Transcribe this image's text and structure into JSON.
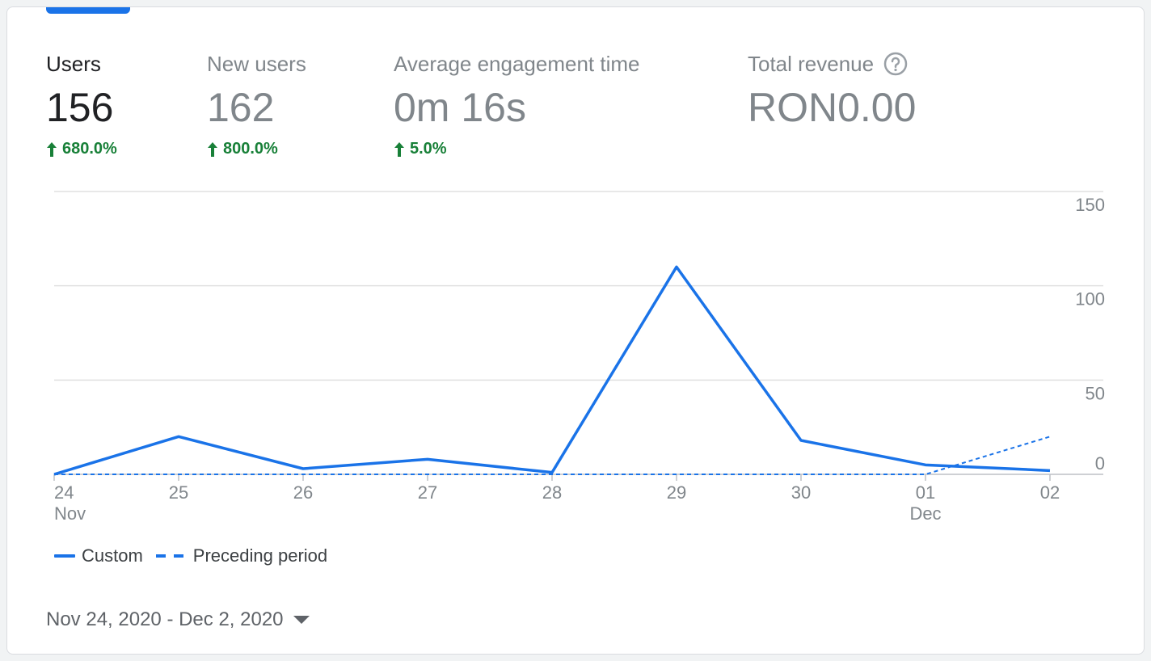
{
  "metrics": [
    {
      "label": "Users",
      "value": "156",
      "change": "680.0%"
    },
    {
      "label": "New users",
      "value": "162",
      "change": "800.0%"
    },
    {
      "label": "Average engagement time",
      "value": "0m 16s",
      "change": "5.0%"
    },
    {
      "label": "Total revenue",
      "value": "RON0.00"
    }
  ],
  "legend": {
    "custom": "Custom",
    "preceding": "Preceding period"
  },
  "date_range": "Nov 24, 2020 - Dec 2, 2020",
  "colors": {
    "accent": "#1a73e8",
    "positive": "#188038",
    "grid": "#e0e0e0",
    "axis_text": "#80868b"
  },
  "chart_data": {
    "type": "line",
    "x_ticks": [
      {
        "day": "24",
        "month": "Nov"
      },
      {
        "day": "25",
        "month": ""
      },
      {
        "day": "26",
        "month": ""
      },
      {
        "day": "27",
        "month": ""
      },
      {
        "day": "28",
        "month": ""
      },
      {
        "day": "29",
        "month": ""
      },
      {
        "day": "30",
        "month": ""
      },
      {
        "day": "01",
        "month": "Dec"
      },
      {
        "day": "02",
        "month": ""
      }
    ],
    "y_ticks": [
      0,
      50,
      100,
      150
    ],
    "ylim": [
      0,
      150
    ],
    "series": [
      {
        "name": "Custom",
        "style": "solid",
        "values": [
          0,
          20,
          3,
          8,
          1,
          110,
          18,
          5,
          2
        ]
      },
      {
        "name": "Preceding period",
        "style": "dashed",
        "values": [
          0,
          0,
          0,
          0,
          0,
          0,
          0,
          0,
          20
        ]
      }
    ]
  }
}
